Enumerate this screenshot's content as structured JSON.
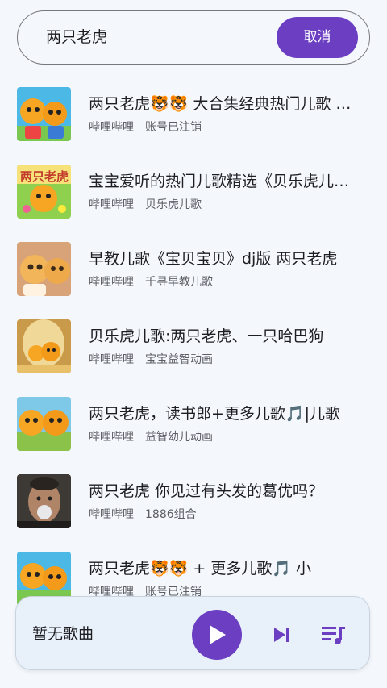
{
  "search": {
    "query": "两只老虎",
    "cancel_label": "取消"
  },
  "results": [
    {
      "title": "两只老虎🐯🐯 大合集经典热门儿歌 宝宝爱听",
      "source": "哔哩哔哩",
      "uploader": "账号已注销",
      "thumb": "cartoon-tigers"
    },
    {
      "title": "宝宝爱听的热门儿歌精选《贝乐虎儿歌》",
      "source": "哔哩哔哩",
      "uploader": "贝乐虎儿歌",
      "thumb": "cartoon-tiger-title"
    },
    {
      "title": "早教儿歌《宝贝宝贝》dj版 两只老虎",
      "source": "哔哩哔哩",
      "uploader": "千寻早教儿歌",
      "thumb": "cartoon-tigers-3d"
    },
    {
      "title": "贝乐虎儿歌:两只老虎、一只哈巴狗",
      "source": "哔哩哔哩",
      "uploader": "宝宝益智动画",
      "thumb": "cartoon-tiger-stage"
    },
    {
      "title": "两只老虎，读书郎+更多儿歌🎵|儿歌",
      "source": "哔哩哔哩",
      "uploader": "益智幼儿动画",
      "thumb": "cartoon-tigers-2"
    },
    {
      "title": "两只老虎 你见过有头发的葛优吗？",
      "source": "哔哩哔哩",
      "uploader": "1886组合",
      "thumb": "person-photo"
    },
    {
      "title": "两只老虎🐯🐯 + 更多儿歌🎵 小",
      "source": "哔哩哔哩",
      "uploader": "账号已注销",
      "thumb": "cartoon-tigers"
    }
  ],
  "player": {
    "now_playing": "暂无歌曲",
    "play_icon": "play-icon",
    "next_icon": "skip-next-icon",
    "queue_icon": "queue-music-icon"
  },
  "colors": {
    "accent": "#6c3fc2",
    "background": "#f4f8fc",
    "player_bg": "#e8f1fa"
  }
}
